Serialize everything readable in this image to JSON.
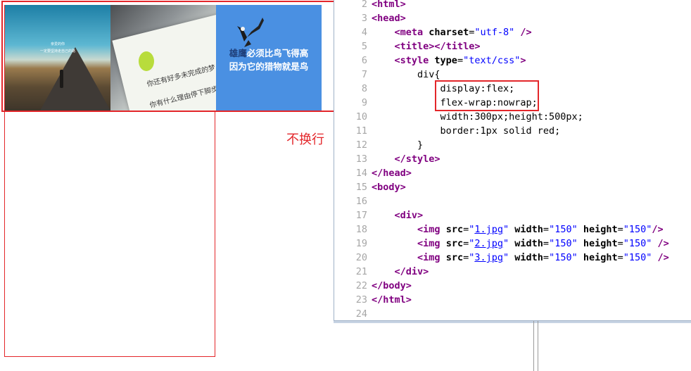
{
  "preview": {
    "image1": {
      "line1": "亲爱的你",
      "line2": "一定要坚持走自己的路"
    },
    "image2": {
      "line1": "你还有好多未完成的梦",
      "line2": "你有什么理由停下脚步"
    },
    "image3": {
      "highlight": "雄鹰",
      "line1_rest": "必须比鸟飞得高",
      "line2": "因为它的猎物就是鸟"
    }
  },
  "annotation": "不换行",
  "colors": {
    "annotation": "#e3262a",
    "tag": "#800080",
    "value": "#0000ff"
  },
  "code": {
    "l2": {
      "n": "2",
      "a": "<",
      "b": "html",
      "c": ">"
    },
    "l3": {
      "n": "3",
      "a": "<",
      "b": "head",
      "c": ">"
    },
    "l4": {
      "n": "4",
      "a": "<",
      "b": "meta",
      "c": " charset",
      "d": "=",
      "e": "\"utf-8\"",
      "f": " />"
    },
    "l5": {
      "n": "5",
      "a": "<",
      "b": "title",
      "c": "></",
      "d": "title",
      "e": ">"
    },
    "l6": {
      "n": "6",
      "a": "<",
      "b": "style",
      "c": " type",
      "d": "=",
      "e": "\"text/css\"",
      "f": ">"
    },
    "l7": {
      "n": "7",
      "a": "div{"
    },
    "l8": {
      "n": "8",
      "a": "display:flex;"
    },
    "l9": {
      "n": "9",
      "a": "flex-wrap:nowrap;"
    },
    "l10": {
      "n": "10",
      "a": "width:300px;height:500px;"
    },
    "l11": {
      "n": "11",
      "a": "border:1px solid red;"
    },
    "l12": {
      "n": "12",
      "a": "}"
    },
    "l13": {
      "n": "13",
      "a": "</",
      "b": "style",
      "c": ">"
    },
    "l14": {
      "n": "14",
      "a": "</",
      "b": "head",
      "c": ">"
    },
    "l15": {
      "n": "15",
      "a": "<",
      "b": "body",
      "c": ">"
    },
    "l16": {
      "n": "16"
    },
    "l17": {
      "n": "17",
      "a": "<",
      "b": "div",
      "c": ">"
    },
    "l18": {
      "n": "18",
      "file": "1.jpg"
    },
    "l19": {
      "n": "19",
      "file": "2.jpg"
    },
    "l20": {
      "n": "20",
      "file": "3.jpg"
    },
    "img_attrs": {
      "open": "<",
      "tag": "img",
      "src": " src",
      "eq": "=",
      "q": "\"",
      "width": " width",
      "w": "\"150\"",
      "height": " height",
      "h": "\"150\"",
      "end1": "/>",
      "end2": " />"
    },
    "l21": {
      "n": "21",
      "a": "</",
      "b": "div",
      "c": ">"
    },
    "l22": {
      "n": "22",
      "a": "</",
      "b": "body",
      "c": ">"
    },
    "l23": {
      "n": "23",
      "a": "</",
      "b": "html",
      "c": ">"
    },
    "l24": {
      "n": "24"
    }
  }
}
